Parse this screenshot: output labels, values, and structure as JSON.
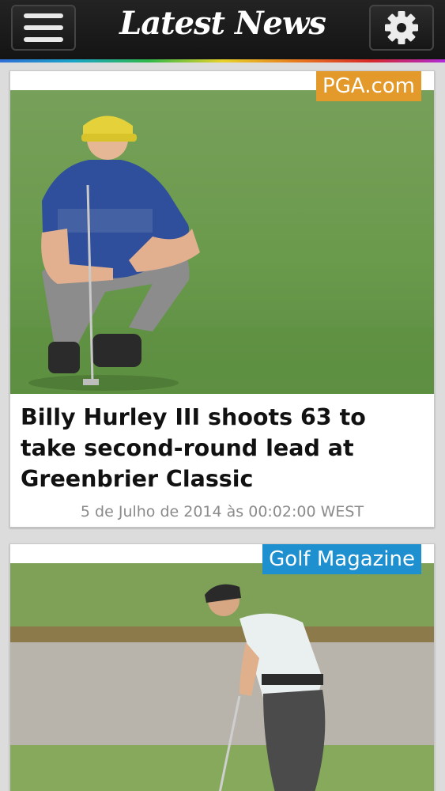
{
  "header": {
    "title": "Latest News",
    "menu_icon": "hamburger-menu-icon",
    "settings_icon": "gear-icon"
  },
  "articles": [
    {
      "source": "PGA.com",
      "source_color": "#e39a2b",
      "headline": "Billy Hurley III shoots 63 to take second-round lead at Greenbrier Classic",
      "date": "5 de Julho de 2014 às 00:02:00 WEST"
    },
    {
      "source": "Golf Magazine",
      "source_color": "#1e8fcf"
    }
  ]
}
